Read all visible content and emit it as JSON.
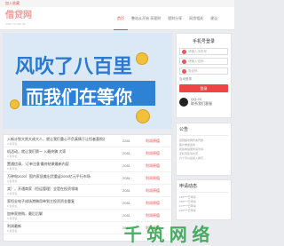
{
  "topbar": {
    "text": "加入收藏"
  },
  "header": {
    "logo": "借贷网",
    "subtitle": "XIAO YU ZHI JIA"
  },
  "nav": [
    "首页",
    "整站从开始 享理财",
    "理财分享",
    "网贷相关",
    "建议"
  ],
  "banner": {
    "line1": "风吹了八百里",
    "line2": "而我们在等你"
  },
  "login": {
    "title": "手机号登录",
    "phone_placeholder": "请输入手机号",
    "password_placeholder": "请输入密码",
    "code_placeholder": "验证码",
    "auto_login": "自动登录",
    "button": "登录",
    "qq_number": "QQ:23",
    "qq_note": "联系我们客服"
  },
  "notice": {
    "title": "公告",
    "lines": [
      "经营超市网传言开通…",
      "客户端加载中…",
      "新版本站服务请访问…",
      "手机专区请访问…",
      "六个月以后加入我们…"
    ]
  },
  "apply": {
    "title": "申请动态",
    "lines": [
      "138****已申请",
      "156****已申请",
      "177****已申请",
      "135****已申请",
      "188****已申请"
    ]
  },
  "list": [
    {
      "title": "入新计划大势大成大人，就让我们重心不负真情于让恒者喜恨迟！",
      "sub": "0 条评论",
      "num": "2281",
      "tag": "利润原值"
    },
    {
      "title": "机活动，就让我们第一 入最终稿 大家",
      "sub": "0 条评论",
      "num": "2081",
      "tag": "利润原值"
    },
    {
      "title": "置通信请，‘订单注意’最终结果最新内容",
      "sub": "0 条评论",
      "num": "2081",
      "tag": "利润原值"
    },
    {
      "title": "万钟电2020）国内家居美出货重返2000亿元平行市场",
      "sub": "0 条评论",
      "num": "2081",
      "tag": "利润原值"
    },
    {
      "title": "卖），开通商家（恒运管理）全是在投资领域",
      "sub": "0 条评论",
      "num": "2081",
      "tag": "利润原值"
    },
    {
      "title": "家恒业电子成场港稿用单到主投资资金重复",
      "sub": "0 条评论",
      "num": "2081",
      "tag": "利润原值"
    },
    {
      "title": "加单家统购，最后后解",
      "sub": "0 条评论",
      "num": "2081",
      "tag": "利润原值"
    },
    {
      "title": "利润最新",
      "sub": "0 条评论",
      "num": "2081",
      "tag": "利润原值"
    }
  ],
  "watermark": "千 筑 网 络"
}
